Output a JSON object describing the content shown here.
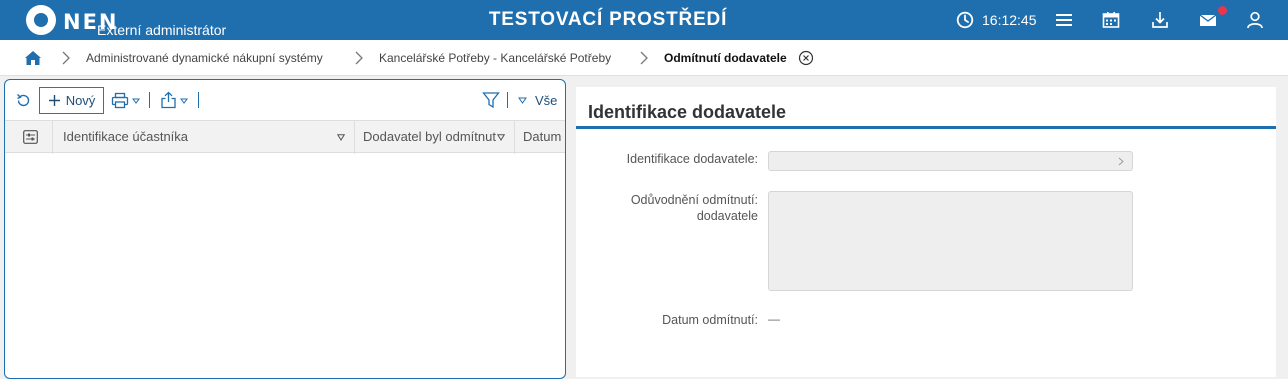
{
  "header": {
    "logo_text": "NEN",
    "logo_subtitle": "Externí administrátor",
    "environment_title": "TESTOVACÍ PROSTŘEDÍ",
    "time": "16:12:45"
  },
  "breadcrumb": [
    {
      "label": "Administrované dynamické nákupní systémy"
    },
    {
      "label": "Kancelářské Potřeby - Kancelářské Potřeby"
    },
    {
      "label": "Odmítnutí dodavatele"
    }
  ],
  "toolbar": {
    "new_label": "Nový",
    "filter_label": "Vše"
  },
  "grid": {
    "columns": [
      {
        "label": "Identifikace účastníka"
      },
      {
        "label": "Dodavatel byl odmítnut"
      },
      {
        "label": "Datum"
      }
    ],
    "rows": []
  },
  "form": {
    "title": "Identifikace dodavatele",
    "fields": {
      "supplier_id_label": "Identifikace dodavatele:",
      "supplier_id_value": "",
      "reason_label_line1": "Odůvodnění odmítnutí:",
      "reason_label_line2": "dodavatele",
      "reason_value": "",
      "date_label": "Datum odmítnutí:",
      "date_value": "—"
    }
  },
  "colors": {
    "brand": "#1f6eae",
    "highlight_border": "#d9343e",
    "notification_badge": "#e8364d"
  }
}
